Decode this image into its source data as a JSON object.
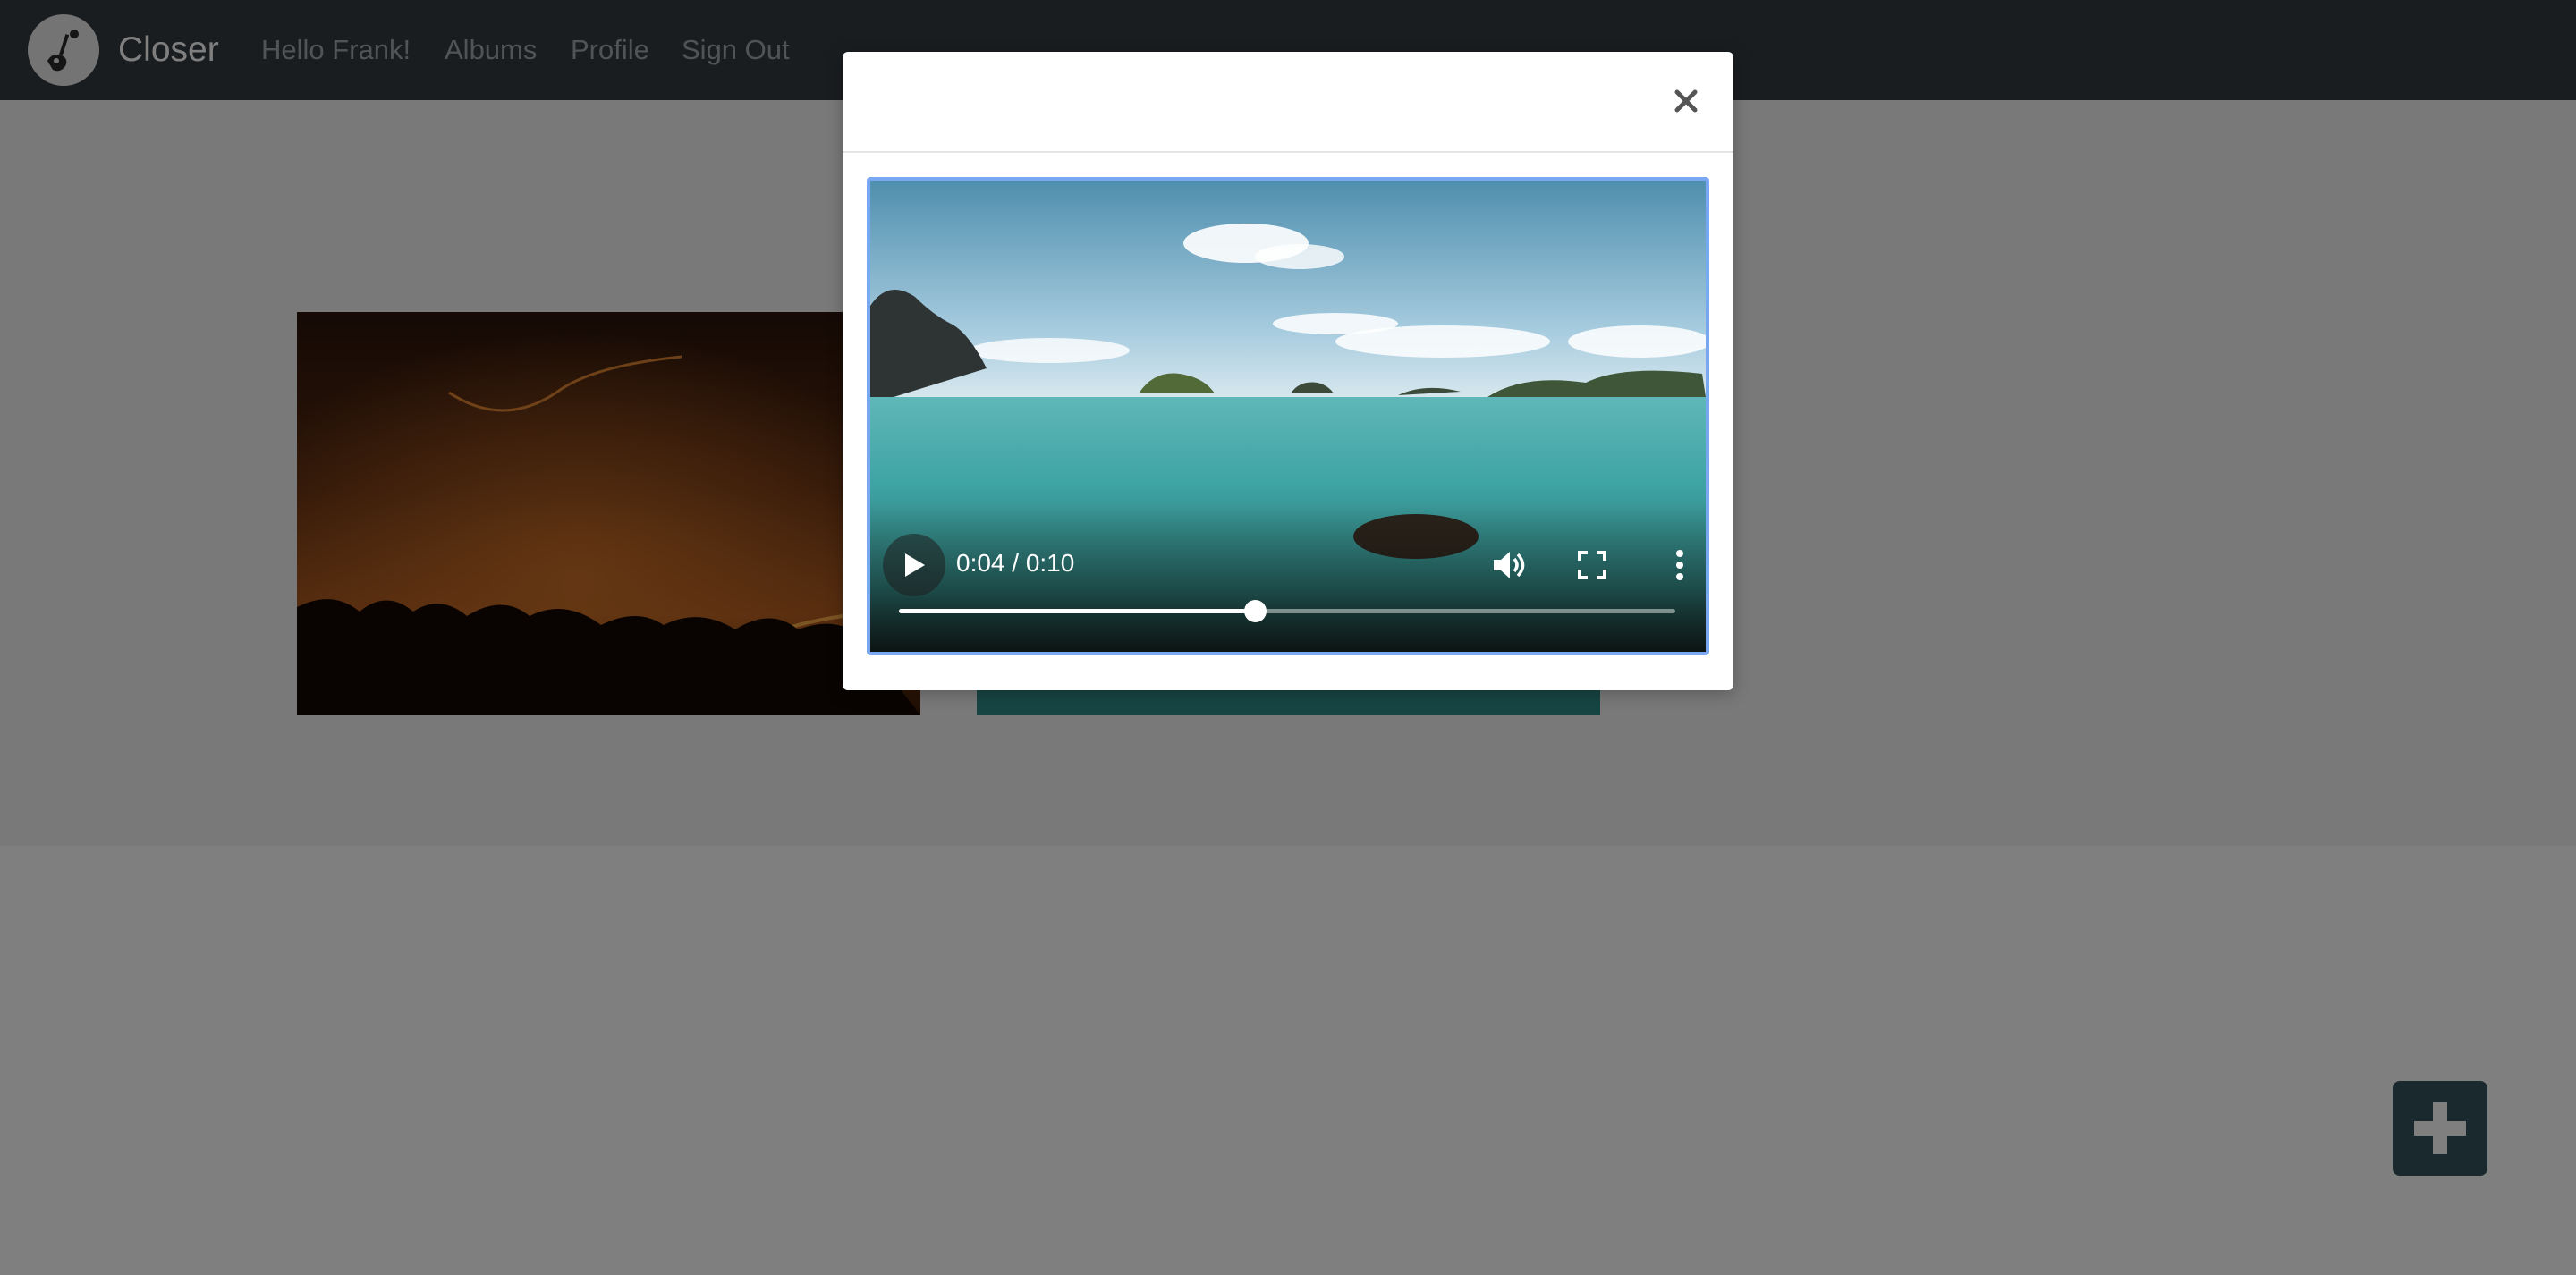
{
  "navbar": {
    "brand": "Closer",
    "greeting": "Hello Frank!",
    "links": {
      "albums": "Albums",
      "profile": "Profile",
      "sign_out": "Sign Out"
    },
    "logo_icon": "guitar-pin-logo-icon"
  },
  "gallery": {
    "items": [
      {
        "kind": "image",
        "subject": "forest fire at night"
      },
      {
        "kind": "video",
        "subject": "sea with islands"
      }
    ]
  },
  "fab": {
    "icon": "plus-icon"
  },
  "modal": {
    "close_label": "×",
    "video": {
      "current_time": "0:04",
      "duration": "0:10",
      "time_display": "0:04 / 0:10",
      "progress_fraction": 0.4586,
      "icons": [
        "play-icon",
        "volume-icon",
        "fullscreen-icon",
        "more-options-icon"
      ]
    }
  },
  "colors": {
    "navbar_bg": "#343a40",
    "fab_bg": "#34535c",
    "focus_ring": "#7aa7f4"
  }
}
